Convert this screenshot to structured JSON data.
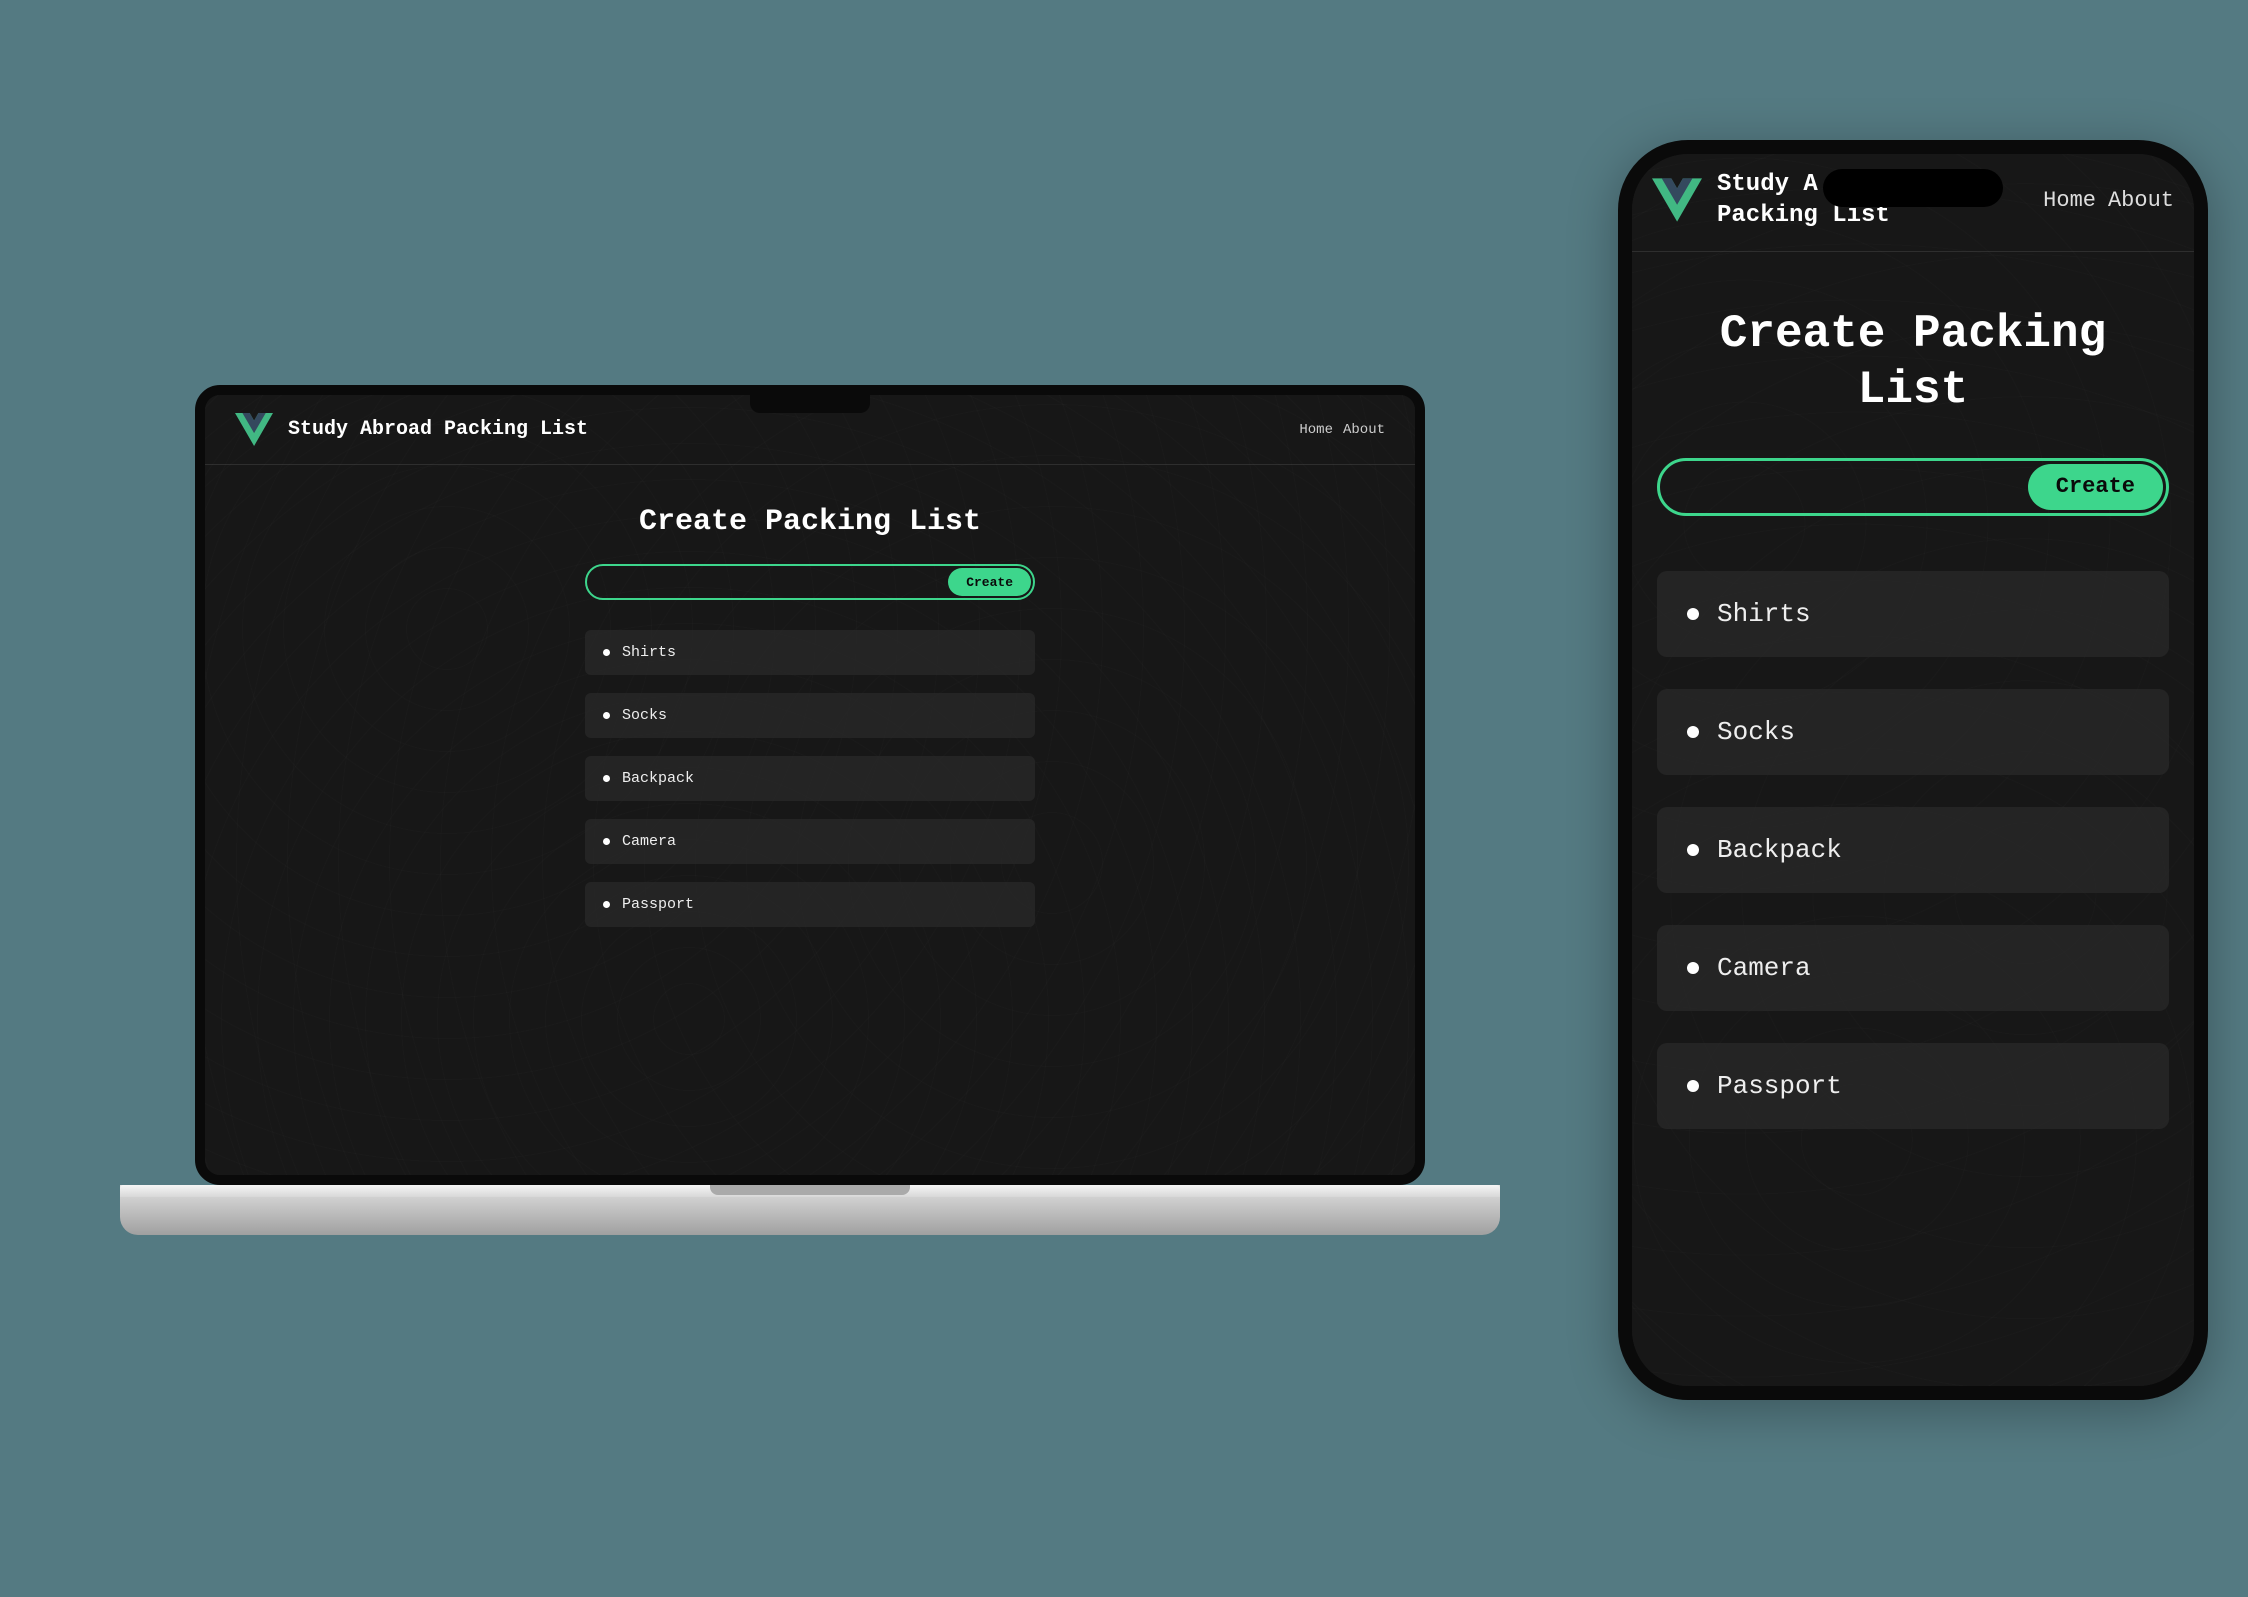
{
  "app": {
    "title_full": "Study Abroad Packing List",
    "title_line1": "Study A",
    "title_line2": "Packing List",
    "nav": {
      "home": "Home",
      "about": "About"
    }
  },
  "main": {
    "heading": "Create Packing List",
    "create_button": "Create",
    "items": [
      "Shirts",
      "Socks",
      "Backpack",
      "Camera",
      "Passport"
    ]
  },
  "colors": {
    "accent": "#3DD68C",
    "bg": "#171717",
    "page_bg": "#547A82"
  }
}
